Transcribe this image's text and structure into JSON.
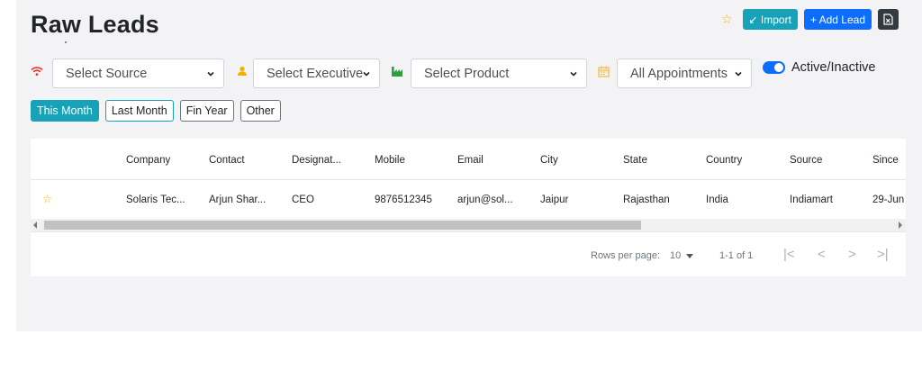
{
  "header": {
    "title": "Raw Leads",
    "import_label": "↙ Import",
    "add_label": "+ Add Lead",
    "icons": {
      "favorite": "star-icon",
      "excel": "excel-file-icon"
    }
  },
  "filters": {
    "source": {
      "value": "Select Source",
      "icon": "wifi-icon"
    },
    "executive": {
      "value": "Select Executive",
      "icon": "user-icon"
    },
    "product": {
      "value": "Select Product",
      "icon": "factory-icon"
    },
    "appointments": {
      "value": "All Appointments",
      "icon": "calendar-icon"
    },
    "toggle_label": "Active/Inactive"
  },
  "period_buttons": [
    "This Month",
    "Last Month",
    "Fin Year",
    "Other"
  ],
  "table": {
    "columns": [
      "Company",
      "Contact",
      "Designat...",
      "Mobile",
      "Email",
      "City",
      "State",
      "Country",
      "Source",
      "Since"
    ],
    "rows": [
      [
        "Solaris Tec...",
        "Arjun Shar...",
        "CEO",
        "9876512345",
        "arjun@sol...",
        "Jaipur",
        "Rajasthan",
        "India",
        "Indiamart",
        "29-Jun"
      ]
    ]
  },
  "pagination": {
    "rows_per_page_label": "Rows per page:",
    "rows_per_page": "10",
    "range": "1-1 of 1",
    "first": "|<",
    "prev": "<",
    "next": ">",
    "last": ">|"
  },
  "colors": {
    "accent_teal": "#17a2b8",
    "primary_blue": "#0d6efd",
    "dark": "#343a40",
    "star": "#f0b400",
    "source_icon": "#e53935",
    "executive_icon": "#f0b400",
    "product_icon": "#2e9e3f",
    "calendar_icon": "#f2c25a"
  }
}
